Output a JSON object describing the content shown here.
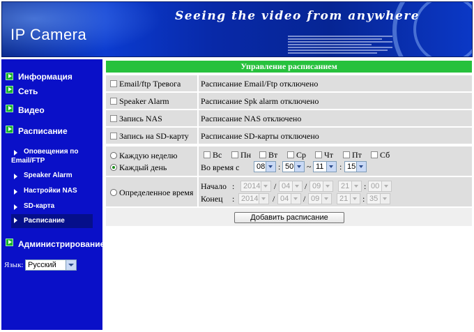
{
  "header": {
    "brand": "IP Camera",
    "slogan": "Seeing the video from anywhere"
  },
  "sidebar": {
    "items": [
      {
        "label": "Информация"
      },
      {
        "label": "Сеть"
      },
      {
        "label": "Видео"
      },
      {
        "label": "Расписание"
      }
    ],
    "sub_items": [
      {
        "label_line1": "Оповещения по",
        "label_line2": "Email/FTP"
      },
      {
        "label": "Speaker Alarm"
      },
      {
        "label": "Настройки NAS"
      },
      {
        "label": "SD-карта"
      },
      {
        "label": "Расписание",
        "active": true
      }
    ],
    "admin": {
      "label": "Администрирование"
    },
    "language": {
      "label": "Язык:",
      "value": "Русский"
    }
  },
  "main": {
    "title": "Управление расписанием",
    "rows": [
      {
        "option": "Email/ftp Тревога",
        "status": "Расписание Email/Ftp отключено"
      },
      {
        "option": "Speaker Alarm",
        "status": "Расписание Spk alarm отключено"
      },
      {
        "option": "Запись NAS",
        "status": "Расписание NAS отключено"
      },
      {
        "option": "Запись на SD-карту",
        "status": "Расписание SD-карты отключено"
      }
    ],
    "repeat": {
      "weekly": "Каждую неделю",
      "daily": "Каждый день",
      "selected": "daily",
      "days": [
        "Вс",
        "Пн",
        "Вт",
        "Ср",
        "Чт",
        "Пт",
        "Сб"
      ],
      "time_label": "Во время с",
      "from_hour": "08",
      "from_min": "50",
      "to_hour": "11",
      "to_min": "15",
      "range_sep": "~",
      "colon": ":"
    },
    "specific": {
      "label": "Определенное время",
      "start_label": "Начало",
      "end_label": "Конец",
      "colon": ":",
      "slash": "/",
      "start": {
        "year": "2014",
        "month": "04",
        "day": "09",
        "hour": "21",
        "min": "00"
      },
      "end": {
        "year": "2014",
        "month": "04",
        "day": "09",
        "hour": "21",
        "min": "35"
      }
    },
    "add_button": "Добавить расписание"
  },
  "colors": {
    "sidebar": "#0a10c8",
    "title_bar": "#27c13d",
    "cell": "#dedede"
  }
}
